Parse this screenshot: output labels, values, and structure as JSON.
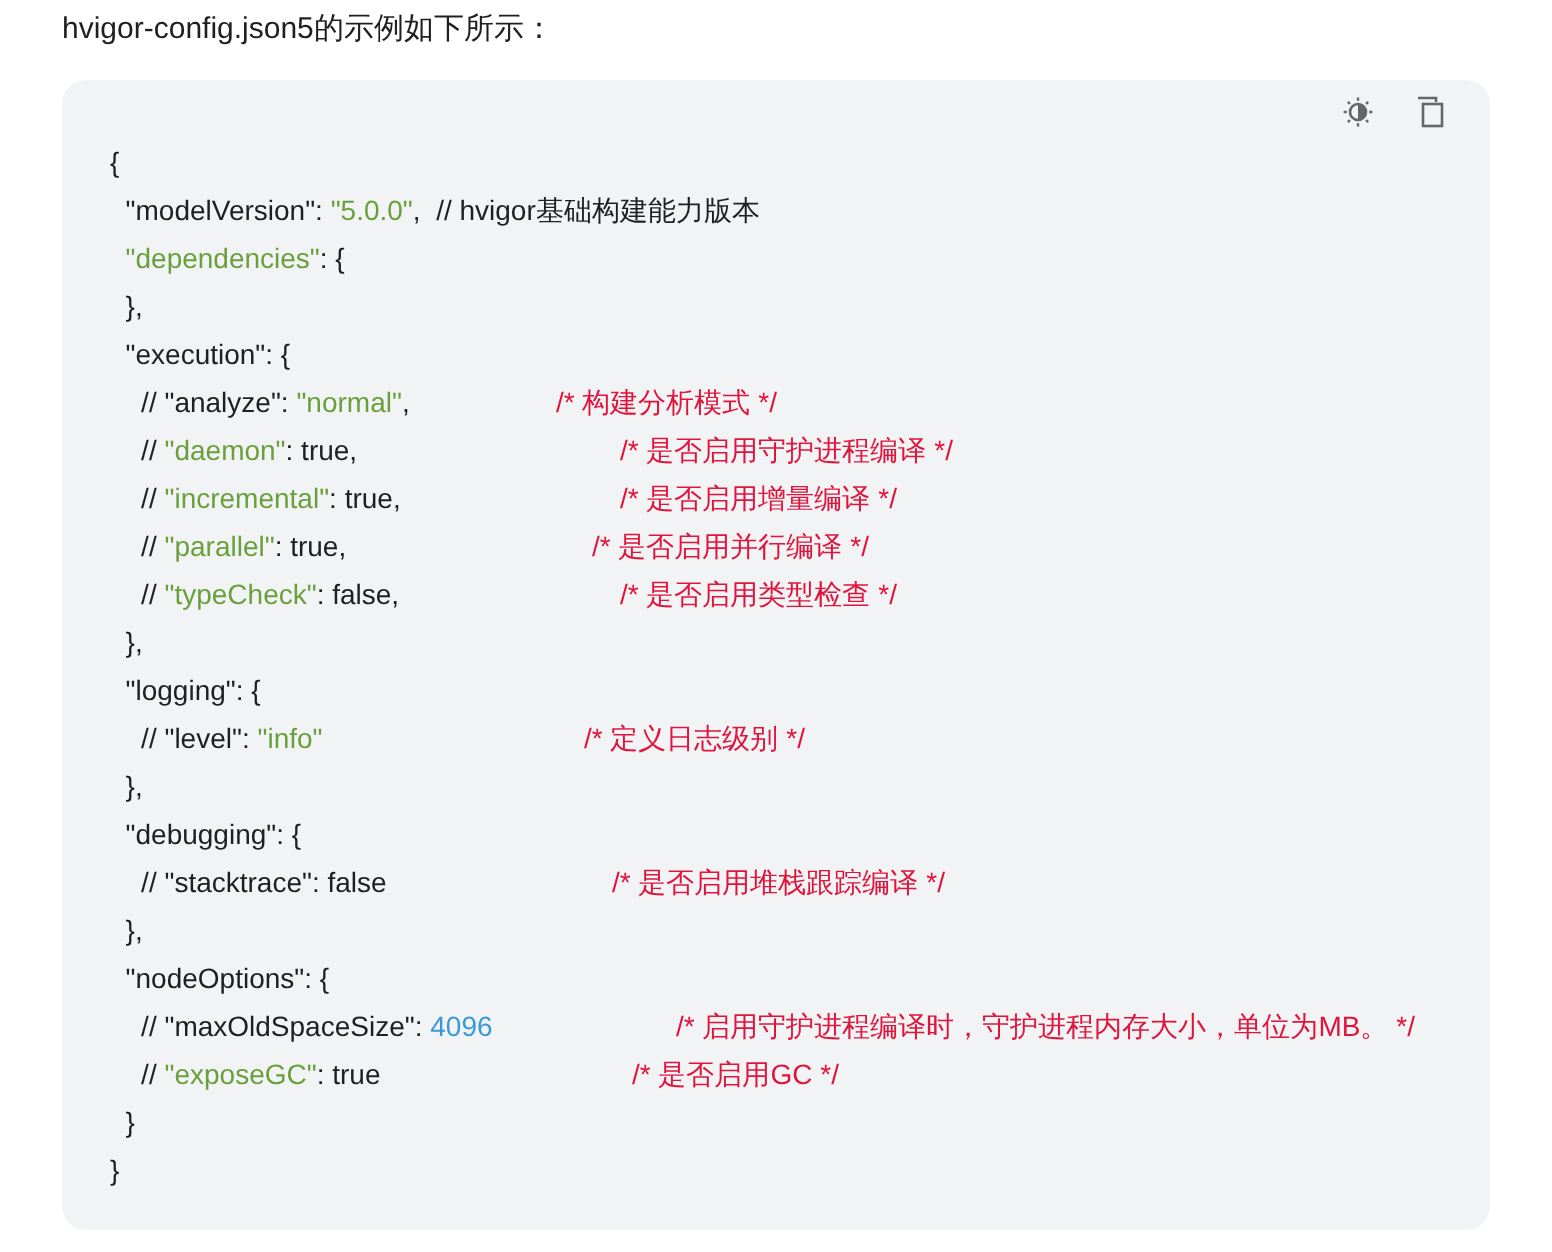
{
  "intro": "hvigor-config.json5的示例如下所示：",
  "code_lines": [
    {
      "segments": [
        {
          "kind": "plain",
          "text": "{"
        }
      ]
    },
    {
      "segments": [
        {
          "kind": "plain",
          "text": "  \"modelVersion\": "
        },
        {
          "kind": "string",
          "text": "\"5.0.0\""
        },
        {
          "kind": "plain",
          "text": ",  // hvigor基础构建能力版本"
        }
      ]
    },
    {
      "segments": [
        {
          "kind": "string",
          "text": "  \"dependencies\""
        },
        {
          "kind": "plain",
          "text": ": {"
        }
      ]
    },
    {
      "segments": [
        {
          "kind": "plain",
          "text": "  },"
        }
      ]
    },
    {
      "segments": [
        {
          "kind": "plain",
          "text": "  \"execution\": {"
        }
      ]
    },
    {
      "segments": [
        {
          "kind": "plain",
          "text": "    // \"analyze\": "
        },
        {
          "kind": "string",
          "text": "\"normal\""
        },
        {
          "kind": "plain",
          "text": ","
        }
      ],
      "comment": "/* 构建分析模式 */"
    },
    {
      "segments": [
        {
          "kind": "plain",
          "text": "    // "
        },
        {
          "kind": "string",
          "text": "\"daemon\""
        },
        {
          "kind": "plain",
          "text": ": true,"
        }
      ],
      "comment": "/* 是否启用守护进程编译 */"
    },
    {
      "segments": [
        {
          "kind": "plain",
          "text": "    // "
        },
        {
          "kind": "string",
          "text": "\"incremental\""
        },
        {
          "kind": "plain",
          "text": ": true,"
        }
      ],
      "comment": "/* 是否启用增量编译 */"
    },
    {
      "segments": [
        {
          "kind": "plain",
          "text": "    // "
        },
        {
          "kind": "string",
          "text": "\"parallel\""
        },
        {
          "kind": "plain",
          "text": ": true,"
        }
      ],
      "comment": "/* 是否启用并行编译 */"
    },
    {
      "segments": [
        {
          "kind": "plain",
          "text": "    // "
        },
        {
          "kind": "string",
          "text": "\"typeCheck\""
        },
        {
          "kind": "plain",
          "text": ": false,"
        }
      ],
      "comment": "/* 是否启用类型检查 */"
    },
    {
      "segments": [
        {
          "kind": "plain",
          "text": "  },"
        }
      ]
    },
    {
      "segments": [
        {
          "kind": "plain",
          "text": "  \"logging\": {"
        }
      ]
    },
    {
      "segments": [
        {
          "kind": "plain",
          "text": "    // \"level\": "
        },
        {
          "kind": "string",
          "text": "\"info\""
        }
      ],
      "comment": "/* 定义日志级别 */"
    },
    {
      "segments": [
        {
          "kind": "plain",
          "text": "  },"
        }
      ]
    },
    {
      "segments": [
        {
          "kind": "plain",
          "text": "  \"debugging\": {"
        }
      ]
    },
    {
      "segments": [
        {
          "kind": "plain",
          "text": "    // \"stacktrace\": false"
        }
      ],
      "comment": "/* 是否启用堆栈跟踪编译 */"
    },
    {
      "segments": [
        {
          "kind": "plain",
          "text": "  },"
        }
      ]
    },
    {
      "segments": [
        {
          "kind": "plain",
          "text": "  \"nodeOptions\": {"
        }
      ]
    },
    {
      "segments": [
        {
          "kind": "plain",
          "text": "    // \"maxOldSpaceSize\": "
        },
        {
          "kind": "number",
          "text": "4096"
        }
      ],
      "comment": "/* 启用守护进程编译时，守护进程内存大小，单位为MB。 */"
    },
    {
      "segments": [
        {
          "kind": "plain",
          "text": "    // "
        },
        {
          "kind": "string",
          "text": "\"exposeGC\""
        },
        {
          "kind": "plain",
          "text": ": true"
        }
      ],
      "comment": "/* 是否启用GC */"
    },
    {
      "segments": [
        {
          "kind": "plain",
          "text": "  }"
        }
      ]
    },
    {
      "segments": [
        {
          "kind": "plain",
          "text": "}"
        }
      ]
    }
  ]
}
